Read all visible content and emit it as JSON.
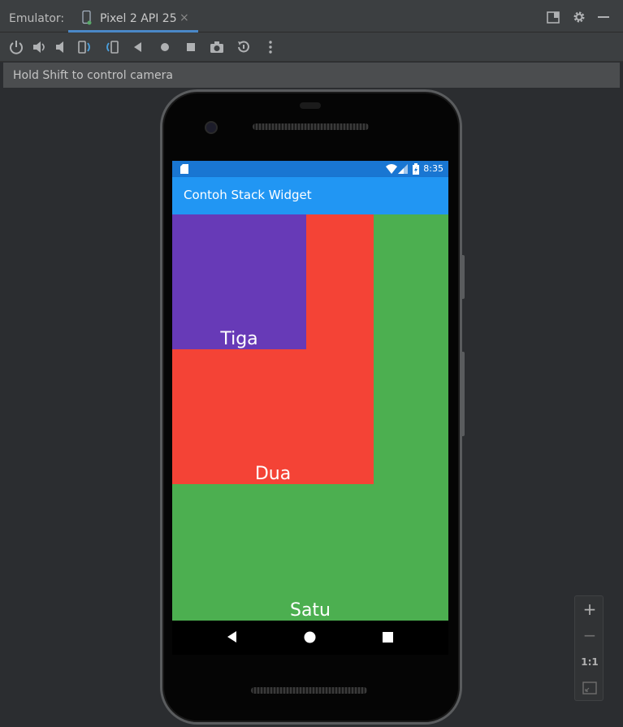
{
  "window": {
    "label": "Emulator:",
    "tab_title": "Pixel 2 API 25",
    "tab_close": "×",
    "icons": [
      "panel-icon",
      "gear-icon",
      "minimize-icon"
    ]
  },
  "toolbar": {
    "buttons": [
      "power-icon",
      "volume-up-icon",
      "volume-down-icon",
      "rotate-left-icon",
      "rotate-right-icon",
      "back-icon",
      "home-icon",
      "overview-icon",
      "camera-icon",
      "snapshot-icon",
      "more-icon"
    ]
  },
  "hint": {
    "text": "Hold Shift to control camera"
  },
  "device": {
    "status": {
      "time": "8:35",
      "icons": [
        "sd-card-icon",
        "wifi-icon",
        "signal-icon",
        "battery-icon"
      ]
    },
    "appbar": {
      "title": "Contoh Stack Widget"
    },
    "boxes": [
      {
        "label": "Satu",
        "color": "#4caf50"
      },
      {
        "label": "Dua",
        "color": "#f44336"
      },
      {
        "label": "Tiga",
        "color": "#673ab7"
      }
    ],
    "nav": [
      "back-icon",
      "home-icon",
      "recents-icon"
    ]
  },
  "zoom": {
    "in": "+",
    "out": "−",
    "actual": "1:1",
    "fit": "fit-icon"
  },
  "colors": {
    "accent": "#4a88c7",
    "appbar": "#2196f3",
    "statusbar": "#1976d2"
  }
}
